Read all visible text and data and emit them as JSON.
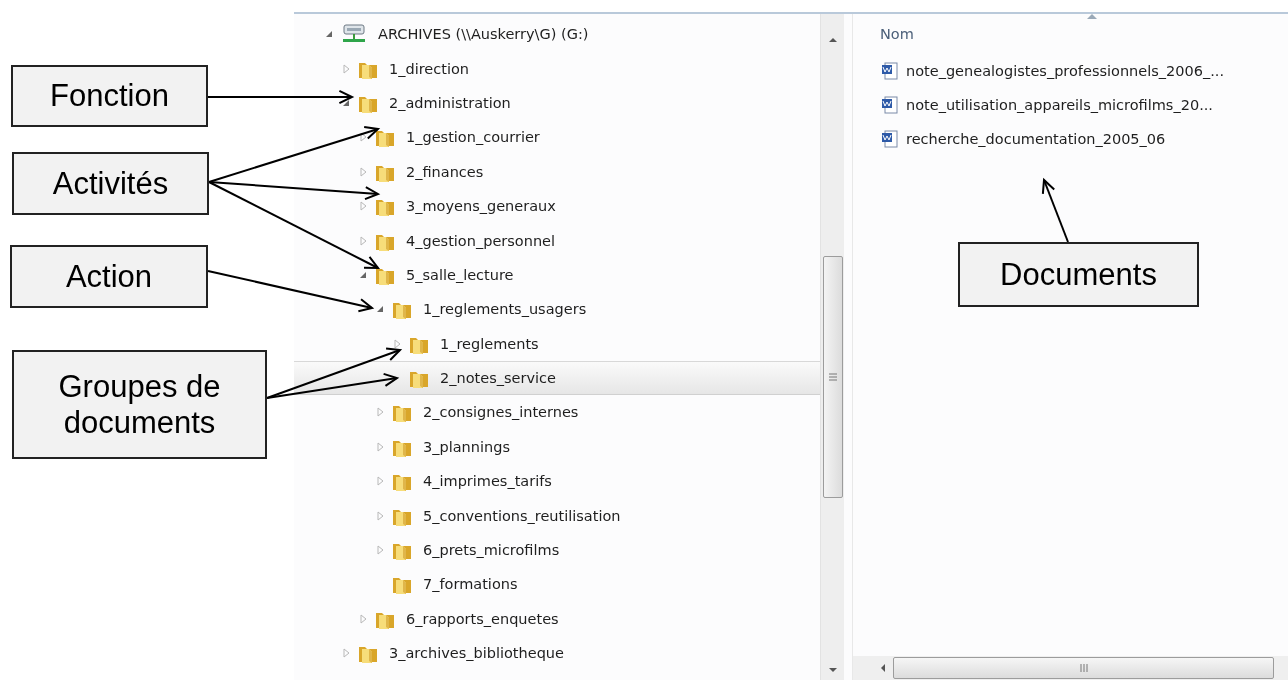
{
  "tree": [
    {
      "label": "ARCHIVES (\\\\Auskerry\\G) (G:)",
      "kind": "drive",
      "expanded": true,
      "selected": false,
      "children": [
        {
          "label": "1_direction",
          "kind": "folder",
          "expanded": false,
          "selected": false
        },
        {
          "label": "2_administration",
          "kind": "folder",
          "expanded": true,
          "selected": false,
          "children": [
            {
              "label": "1_gestion_courrier",
              "kind": "folder",
              "expanded": false,
              "selected": false
            },
            {
              "label": "2_finances",
              "kind": "folder",
              "expanded": false,
              "selected": false
            },
            {
              "label": "3_moyens_generaux",
              "kind": "folder",
              "expanded": false,
              "selected": false
            },
            {
              "label": "4_gestion_personnel",
              "kind": "folder",
              "expanded": false,
              "selected": false
            },
            {
              "label": "5_salle_lecture",
              "kind": "folder",
              "expanded": true,
              "selected": false,
              "children": [
                {
                  "label": "1_reglements_usagers",
                  "kind": "folder",
                  "expanded": true,
                  "selected": false,
                  "children": [
                    {
                      "label": "1_reglements",
                      "kind": "folder",
                      "expanded": false,
                      "selected": false
                    },
                    {
                      "label": "2_notes_service",
                      "kind": "folder",
                      "selected": true
                    }
                  ]
                },
                {
                  "label": "2_consignes_internes",
                  "kind": "folder",
                  "expanded": false,
                  "selected": false
                },
                {
                  "label": "3_plannings",
                  "kind": "folder",
                  "expanded": false,
                  "selected": false
                },
                {
                  "label": "4_imprimes_tarifs",
                  "kind": "folder",
                  "expanded": false,
                  "selected": false
                },
                {
                  "label": "5_conventions_reutilisation",
                  "kind": "folder",
                  "expanded": false,
                  "selected": false
                },
                {
                  "label": "6_prets_microfilms",
                  "kind": "folder",
                  "expanded": false,
                  "selected": false
                },
                {
                  "label": "7_formations",
                  "kind": "folder",
                  "selected": false
                }
              ]
            },
            {
              "label": "6_rapports_enquetes",
              "kind": "folder",
              "expanded": false,
              "selected": false
            }
          ]
        },
        {
          "label": "3_archives_bibliotheque",
          "kind": "folder",
          "expanded": false,
          "selected": false
        }
      ]
    }
  ],
  "files": {
    "column": "Nom",
    "items": [
      {
        "name": "note_genealogistes_professionnels_2006_..."
      },
      {
        "name": "note_utilisation_appareils_microfilms_20..."
      },
      {
        "name": "recherche_documentation_2005_06"
      }
    ]
  },
  "callouts": [
    {
      "text": "Fonction"
    },
    {
      "text": "Activités"
    },
    {
      "text": "Action"
    },
    {
      "text": "Groupes de documents"
    },
    {
      "text": "Documents"
    }
  ]
}
